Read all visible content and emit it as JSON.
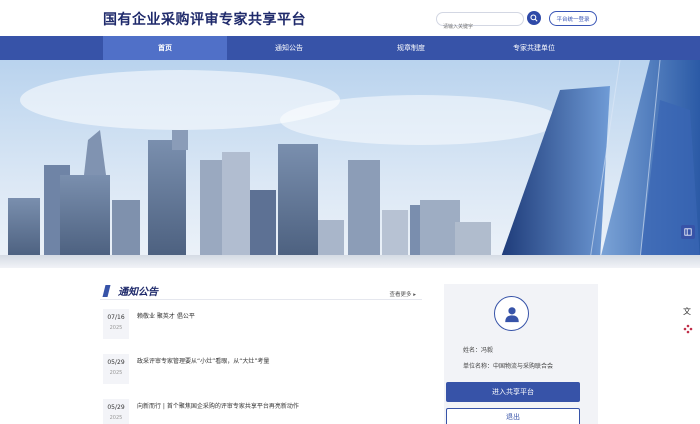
{
  "header": {
    "site_title": "国有企业采购评审专家共享平台",
    "search_placeholder": "请输入关键字",
    "login_label": "平台统一登录"
  },
  "nav": {
    "items": [
      {
        "label": "首页",
        "active": true
      },
      {
        "label": "通知公告",
        "active": false
      },
      {
        "label": "规章制度",
        "active": false
      },
      {
        "label": "专家共建单位",
        "active": false
      }
    ]
  },
  "notices": {
    "title": "通知公告",
    "more_label": "查看更多",
    "items": [
      {
        "md": "07/16",
        "year": "2025",
        "text": "赖敬业 聚英才 倡公平"
      },
      {
        "md": "05/29",
        "year": "2025",
        "text": "政采评审专家管理要从“小灶”看眼，从“大灶”考量"
      },
      {
        "md": "05/29",
        "year": "2025",
        "text": "向新而行 | 首个聚焦国企采购的评审专家共享平台再亮新动作"
      }
    ]
  },
  "profile": {
    "name_label": "姓名：",
    "name_value": "冯毅",
    "unit_label": "单位名称：",
    "unit_value": "中国物流与采购联合会",
    "enter_label": "进入共享平台",
    "logout_label": "退出"
  },
  "colors": {
    "primary": "#3753a8",
    "title": "#1f2a6b",
    "nav_active": "#5070c8",
    "card_bg": "#f2f3f7"
  }
}
